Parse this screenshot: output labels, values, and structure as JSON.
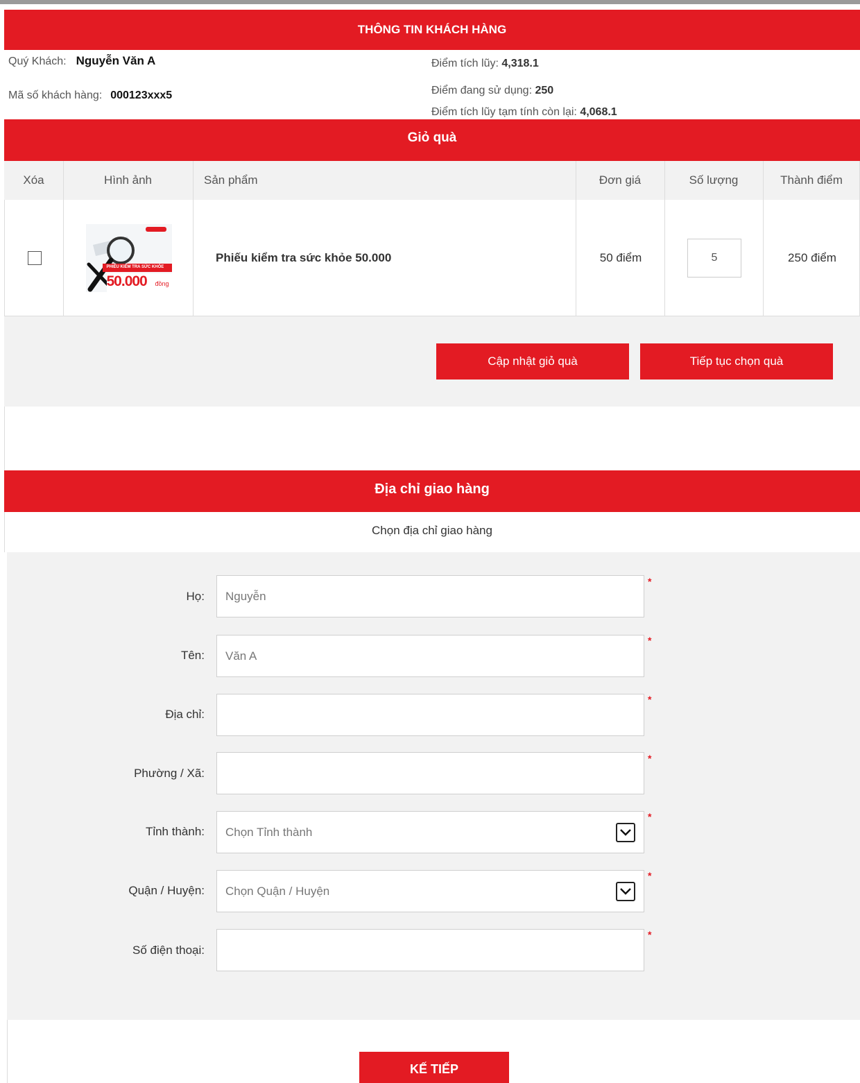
{
  "customer_info": {
    "title": "THÔNG TIN KHÁCH HÀNG",
    "name_label": "Quý Khách:",
    "name_value": "Nguyễn Văn A",
    "code_label": "Mã số khách hàng:",
    "code_value": "000123xxx5",
    "accumulated_label": "Điểm tích lũy:",
    "accumulated_value": "4,318.1",
    "using_label": "Điểm đang sử dụng:",
    "using_value": "250",
    "remaining_label": "Điểm tích lũy tạm tính còn lại:",
    "remaining_value": "4,068.1"
  },
  "cart": {
    "title": "Giỏ quà",
    "columns": [
      "Xóa",
      "Hình ảnh",
      "Sản phẩm",
      "Đơn giá",
      "Số lượng",
      "Thành điểm"
    ],
    "rows": [
      {
        "product": "Phiếu kiểm tra sức khỏe 50.000",
        "unit_price": "50 điểm",
        "quantity": "5",
        "total": "250 điểm",
        "image_text_top": "PHIẾU KIỂM TRA SỨC KHỎE",
        "image_text_amount": "50.000",
        "image_text_unit": "đồng"
      }
    ],
    "update_button": "Cập nhật giỏ quà",
    "continue_button": "Tiếp tục chọn quà"
  },
  "shipping": {
    "title": "Địa chỉ giao hàng",
    "choose_label": "Chọn địa chỉ giao hàng",
    "fields": {
      "last_name": {
        "label": "Họ:",
        "value": "Nguyễn"
      },
      "first_name": {
        "label": "Tên:",
        "value": "Văn A"
      },
      "address": {
        "label": "Địa chỉ:",
        "value": ""
      },
      "ward": {
        "label": "Phường / Xã:",
        "value": ""
      },
      "province": {
        "label": "Tỉnh thành:",
        "value": "Chọn Tỉnh thành"
      },
      "district": {
        "label": "Quận / Huyện:",
        "value": "Chọn Quận / Huyện"
      },
      "phone": {
        "label": "Số điện thoại:",
        "value": ""
      }
    },
    "required_mark": "*",
    "next_button": "KẾ TIẾP"
  },
  "colors": {
    "brand_red": "#e31b23",
    "panel_gray": "#f2f2f2"
  },
  "icons": {
    "select_arrow": "chevron-down-icon",
    "voucher": "magnifier-icon"
  }
}
